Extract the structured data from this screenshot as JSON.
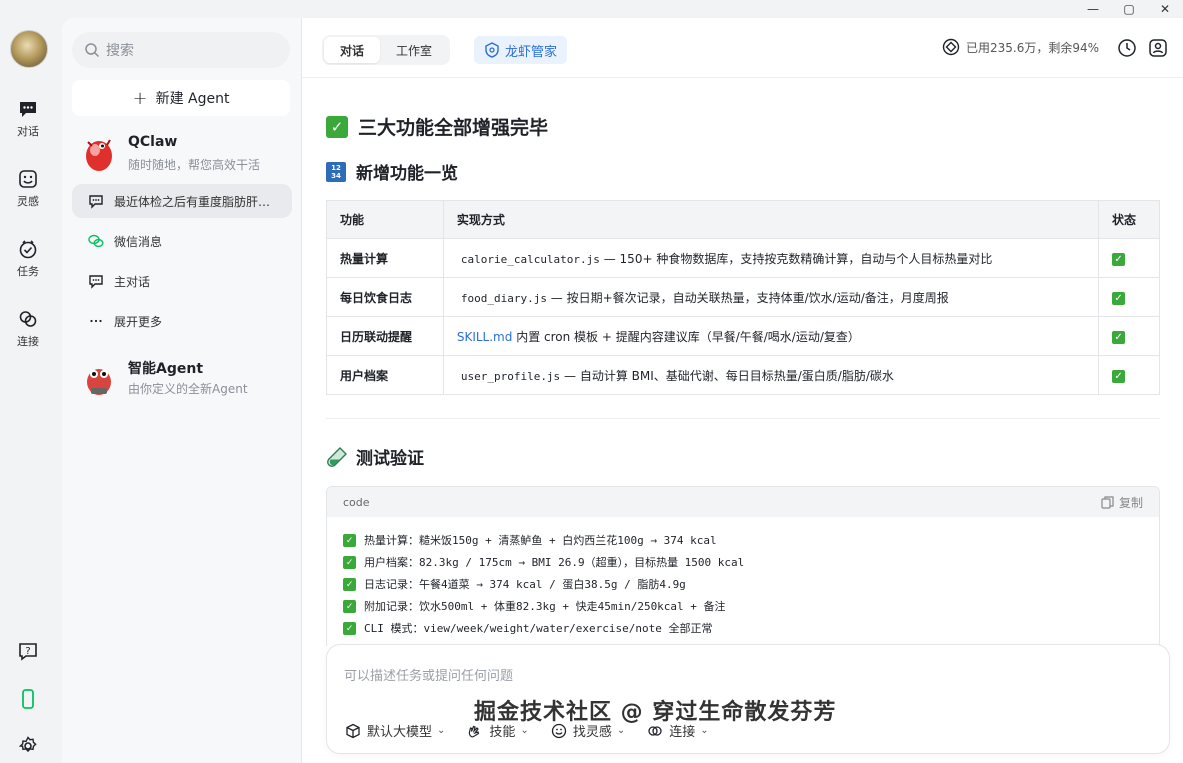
{
  "window": {
    "controls": [
      "—",
      "▢",
      "✕"
    ]
  },
  "rail": {
    "items": [
      {
        "label": "对话"
      },
      {
        "label": "灵感"
      },
      {
        "label": "任务"
      },
      {
        "label": "连接"
      }
    ]
  },
  "sidebar": {
    "search_placeholder": "搜索",
    "new_agent": "新建 Agent",
    "agents": [
      {
        "name": "QClaw",
        "desc": "随时随地，帮您高效干活"
      },
      {
        "name": "智能Agent",
        "desc": "由你定义的全新Agent"
      }
    ],
    "items": [
      {
        "label": "最近体检之后有重度脂肪肝…"
      },
      {
        "label": "微信消息"
      },
      {
        "label": "主对话"
      },
      {
        "label": "展开更多"
      }
    ]
  },
  "header": {
    "tabs": [
      {
        "label": "对话"
      },
      {
        "label": "工作室"
      }
    ],
    "butler": "龙虾管家",
    "usage": "已用235.6万，剩余94%"
  },
  "content": {
    "h1": "三大功能全部增强完毕",
    "h2": "新增功能一览",
    "table": {
      "headers": [
        "功能",
        "实现方式",
        "状态"
      ],
      "rows": [
        {
          "feature": "热量计算",
          "code": "calorie_calculator.js",
          "desc": " — 150+ 种食物数据库，支持按克数精确计算，自动与个人目标热量对比"
        },
        {
          "feature": "每日饮食日志",
          "code": "food_diary.js",
          "desc": " — 按日期+餐次记录，自动关联热量，支持体重/饮水/运动/备注，月度周报"
        },
        {
          "feature": "日历联动提醒",
          "link": "SKILL.md",
          "desc": " 内置 cron 模板 + 提醒内容建议库（早餐/午餐/喝水/运动/复查）"
        },
        {
          "feature": "用户档案",
          "code": "user_profile.js",
          "desc": " — 自动计算 BMI、基础代谢、每日目标热量/蛋白质/脂肪/碳水"
        }
      ]
    },
    "h3": "测试验证",
    "code_block": {
      "lang": "code",
      "copy": "复制",
      "lines": [
        "热量计算：糙米饭150g + 清蒸鲈鱼 + 白灼西兰花100g → 374 kcal",
        "用户档案：82.3kg / 175cm → BMI 26.9（超重），目标热量 1500 kcal",
        "日志记录：午餐4道菜 → 374 kcal / 蛋白38.5g / 脂肪4.9g",
        "附加记录：饮水500ml + 体重82.3kg + 快走45min/250kcal + 备注",
        "CLI 模式：view/week/weight/water/exercise/note 全部正常"
      ]
    }
  },
  "input": {
    "placeholder": "可以描述任务或提问任何问题",
    "tools": [
      {
        "label": "默认大模型"
      },
      {
        "label": "技能"
      },
      {
        "label": "找灵感"
      },
      {
        "label": "连接"
      }
    ]
  },
  "watermark": "掘金技术社区 @ 穿过生命散发芬芳",
  "colors": {
    "accent": "#2b6fd6",
    "check_green": "#3aa93a",
    "wechat_green": "#07c160"
  }
}
